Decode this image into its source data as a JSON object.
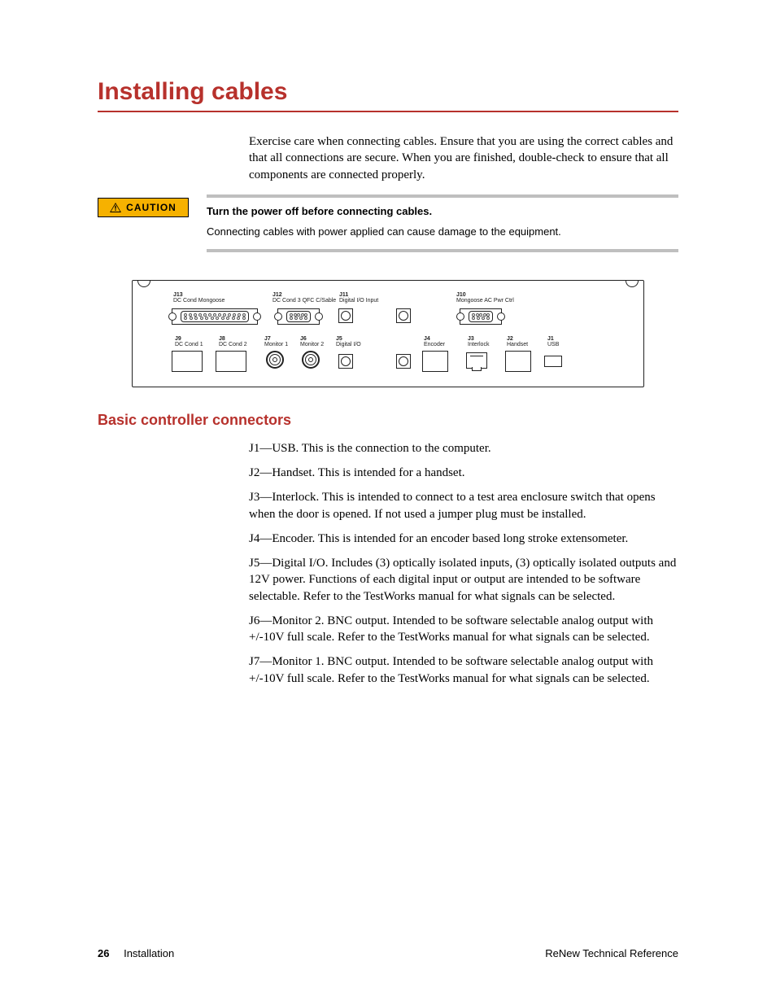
{
  "title": "Installing cables",
  "intro": "Exercise care when connecting cables. Ensure that you are using the correct cables and that all connections are secure. When you are finished, double-check to ensure that all components are connected properly.",
  "caution": {
    "badge": "CAUTION",
    "headline": "Turn the power off before connecting cables.",
    "body": "Connecting cables with power applied can cause damage to the equipment."
  },
  "diagram": {
    "row1": [
      {
        "id": "J13",
        "name": "DC Cond Mongoose"
      },
      {
        "id": "J12",
        "name": "DC Cond 3 QFC C/Sable"
      },
      {
        "id": "J11",
        "name": "Digital I/O Input"
      },
      {
        "id": "J10",
        "name": "Mongoose AC Pwr Ctrl"
      }
    ],
    "row2": [
      {
        "id": "J9",
        "name": "DC Cond 1"
      },
      {
        "id": "J8",
        "name": "DC Cond 2"
      },
      {
        "id": "J7",
        "name": "Monitor 1"
      },
      {
        "id": "J6",
        "name": "Monitor 2"
      },
      {
        "id": "J5",
        "name": "Digital I/O"
      },
      {
        "id": "J4",
        "name": "Encoder"
      },
      {
        "id": "J3",
        "name": "Interlock"
      },
      {
        "id": "J2",
        "name": "Handset"
      },
      {
        "id": "J1",
        "name": "USB"
      }
    ]
  },
  "section_title": "Basic controller connectors",
  "definitions": [
    "J1—USB. This is the connection to the computer.",
    "J2—Handset. This is intended for a handset.",
    "J3—Interlock. This is intended to connect to a test area enclosure switch that opens when the door is opened. If not used a jumper plug must be installed.",
    "J4—Encoder. This is intended for an encoder based long stroke extensometer.",
    "J5—Digital I/O. Includes (3) optically isolated inputs, (3) optically isolated outputs and 12V power. Functions of each digital input or output are intended to be software selectable. Refer to the TestWorks manual for what signals can be selected.",
    "J6—Monitor 2. BNC output. Intended to be software selectable analog output with +/-10V full scale. Refer to the TestWorks manual for what signals can be selected.",
    "J7—Monitor 1. BNC output. Intended to be software selectable analog output with +/-10V full scale. Refer to the TestWorks manual for what signals can be selected."
  ],
  "footer": {
    "page_number": "26",
    "section": "Installation",
    "doc_title": "ReNew Technical Reference"
  }
}
